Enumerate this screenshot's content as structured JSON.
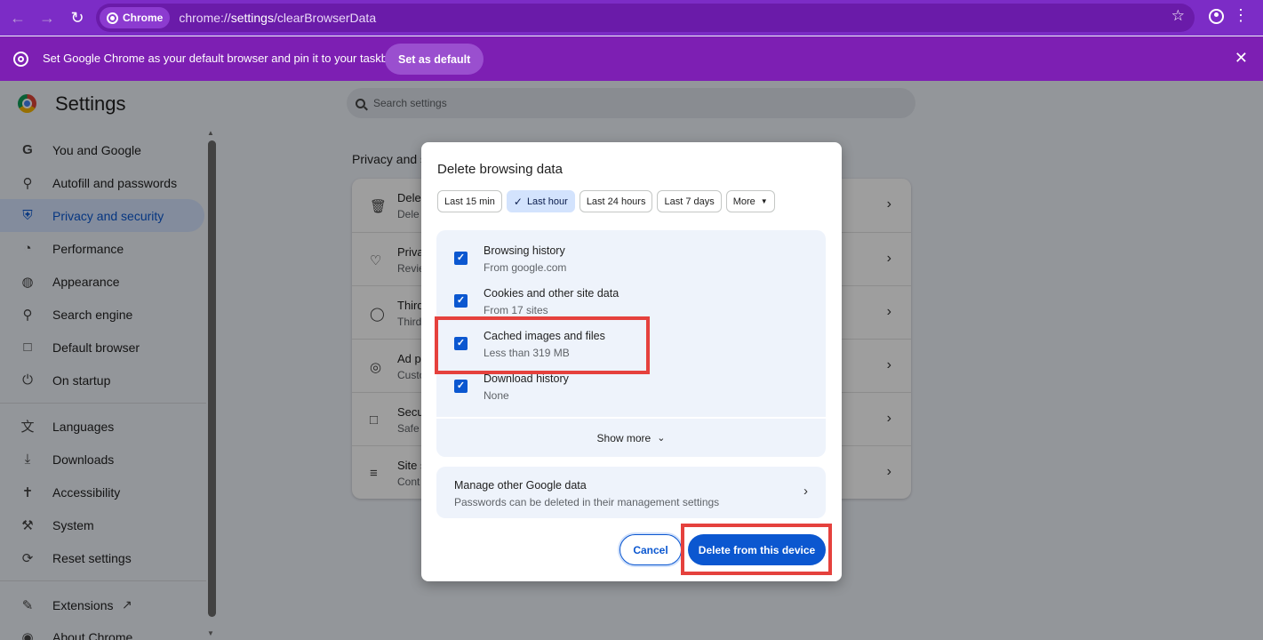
{
  "browser": {
    "chip_label": "Chrome",
    "url_prefix": "chrome://",
    "url_main": "settings",
    "url_rest": "/clearBrowserData"
  },
  "infobar": {
    "message": "Set Google Chrome as your default browser and pin it to your taskbar",
    "button": "Set as default"
  },
  "settings": {
    "title": "Settings",
    "search_placeholder": "Search settings",
    "section_title": "Privacy and s",
    "sidebar": [
      {
        "label": "You and Google",
        "icon": "google-icon"
      },
      {
        "label": "Autofill and passwords",
        "icon": "key-icon"
      },
      {
        "label": "Privacy and security",
        "icon": "shield-icon",
        "active": true
      },
      {
        "label": "Performance",
        "icon": "speedometer-icon"
      },
      {
        "label": "Appearance",
        "icon": "palette-icon"
      },
      {
        "label": "Search engine",
        "icon": "search-icon"
      },
      {
        "label": "Default browser",
        "icon": "browser-window-icon"
      },
      {
        "label": "On startup",
        "icon": "power-icon"
      },
      {
        "label": "Languages",
        "icon": "translate-icon"
      },
      {
        "label": "Downloads",
        "icon": "download-icon"
      },
      {
        "label": "Accessibility",
        "icon": "accessibility-icon"
      },
      {
        "label": "System",
        "icon": "wrench-icon"
      },
      {
        "label": "Reset settings",
        "icon": "reset-icon"
      },
      {
        "label": "Extensions",
        "icon": "puzzle-icon"
      },
      {
        "label": "About Chrome",
        "icon": "chrome-icon"
      }
    ],
    "card_rows": [
      {
        "t1": "Dele",
        "t2": "Dele",
        "icon": "trash-icon"
      },
      {
        "t1": "Priva",
        "t2": "Revie",
        "icon": "signpost-icon"
      },
      {
        "t1": "Third",
        "t2": "Third",
        "icon": "cookie-icon"
      },
      {
        "t1": "Ad p",
        "t2": "Custo",
        "icon": "ad-target-icon"
      },
      {
        "t1": "Secu",
        "t2": "Safe",
        "icon": "lock-icon"
      },
      {
        "t1": "Site s",
        "t2": "Cont",
        "icon": "sliders-icon"
      }
    ]
  },
  "dialog": {
    "title": "Delete browsing data",
    "ranges": [
      {
        "label": "Last 15 min",
        "selected": false
      },
      {
        "label": "Last hour",
        "selected": true
      },
      {
        "label": "Last 24 hours",
        "selected": false
      },
      {
        "label": "Last 7 days",
        "selected": false
      },
      {
        "label": "More",
        "selected": false
      }
    ],
    "items": [
      {
        "title": "Browsing history",
        "sub": "From google.com",
        "checked": true
      },
      {
        "title": "Cookies and other site data",
        "sub": "From 17 sites",
        "checked": true
      },
      {
        "title": "Cached images and files",
        "sub": "Less than 319 MB",
        "checked": true
      },
      {
        "title": "Download history",
        "sub": "None",
        "checked": true
      }
    ],
    "show_more": "Show more",
    "manage_title": "Manage other Google data",
    "manage_sub": "Passwords can be deleted in their management settings",
    "cancel": "Cancel",
    "delete": "Delete from this device"
  },
  "colors": {
    "accent": "#0b57d0",
    "highlight": "#e5413d",
    "browser_frame": "#7c2cc6"
  }
}
